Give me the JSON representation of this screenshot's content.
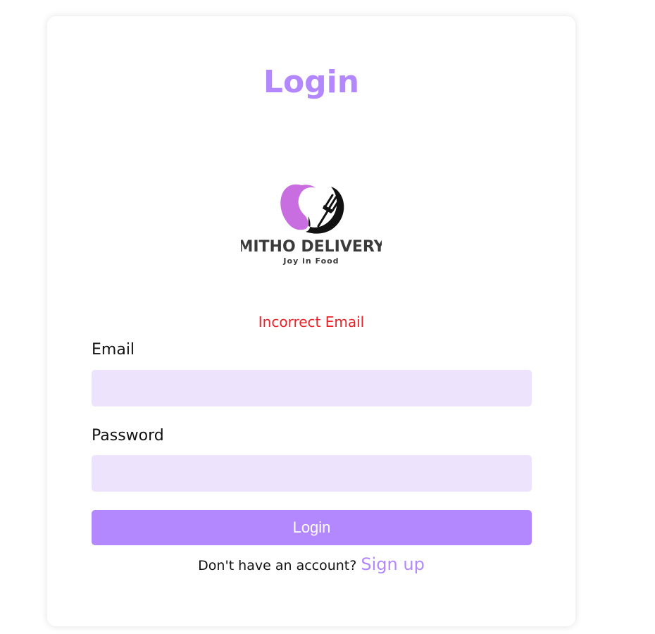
{
  "colors": {
    "accent": "#b388ff",
    "input_bg": "#ede3fd",
    "error": "#e8232a",
    "logo_leaf": "#c86ee0"
  },
  "page_title": "Login",
  "logo": {
    "brand": "MITHO DELIVERY",
    "tagline": "Joy in Food",
    "icon": "leaf-fork-icon"
  },
  "error_message": "Incorrect Email",
  "form": {
    "email_label": "Email",
    "email_value": "",
    "password_label": "Password",
    "password_value": "",
    "submit_label": "Login"
  },
  "signup": {
    "prompt": "Don't have an account?",
    "link_label": "Sign up"
  }
}
